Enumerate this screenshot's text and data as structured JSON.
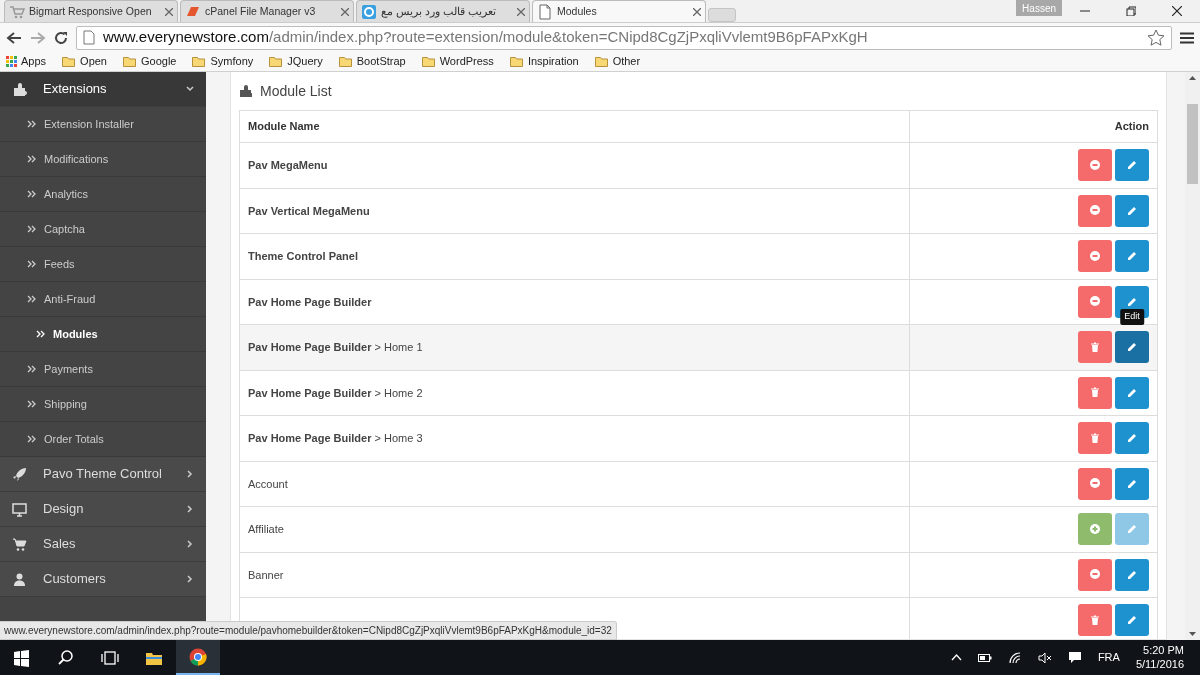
{
  "browser": {
    "tabs": [
      {
        "title": "Bigmart Responsive Open",
        "selected": false
      },
      {
        "title": "cPanel File Manager v3",
        "selected": false
      },
      {
        "title": "تعريب قالب ورد بريس مع",
        "selected": false
      },
      {
        "title": "Modules",
        "selected": true
      }
    ],
    "user": "Hassen",
    "address": {
      "host": "www.everynewstore.com",
      "path": "/admin/index.php?route=extension/module&token=CNipd8CgZjPxqliVvlemt9B6pFAPxKgH"
    },
    "bookmarks": [
      {
        "label": "Apps",
        "kind": "apps"
      },
      {
        "label": "Open",
        "kind": "folder"
      },
      {
        "label": "Google",
        "kind": "folder"
      },
      {
        "label": "Symfony",
        "kind": "folder"
      },
      {
        "label": "JQuery",
        "kind": "folder"
      },
      {
        "label": "BootStrap",
        "kind": "folder"
      },
      {
        "label": "WordPress",
        "kind": "folder"
      },
      {
        "label": "Inspiration",
        "kind": "folder"
      },
      {
        "label": "Other",
        "kind": "folder"
      }
    ],
    "status_url": "www.everynewstore.com/admin/index.php?route=module/pavhomebuilder&token=CNipd8CgZjPxqliVvlemt9B6pFAPxKgH&module_id=32"
  },
  "sidebar": {
    "items": [
      {
        "label": "Extensions",
        "expanded": true,
        "children": [
          {
            "label": "Extension Installer",
            "selected": false
          },
          {
            "label": "Modifications",
            "selected": false
          },
          {
            "label": "Analytics",
            "selected": false
          },
          {
            "label": "Captcha",
            "selected": false
          },
          {
            "label": "Feeds",
            "selected": false
          },
          {
            "label": "Anti-Fraud",
            "selected": false
          },
          {
            "label": "Modules",
            "selected": true
          },
          {
            "label": "Payments",
            "selected": false
          },
          {
            "label": "Shipping",
            "selected": false
          },
          {
            "label": "Order Totals",
            "selected": false
          }
        ]
      },
      {
        "label": "Pavo Theme Control",
        "expanded": false
      },
      {
        "label": "Design",
        "expanded": false
      },
      {
        "label": "Sales",
        "expanded": false
      },
      {
        "label": "Customers",
        "expanded": false
      }
    ]
  },
  "panel": {
    "title": "Module List",
    "table": {
      "columns": [
        "Module Name",
        "Action"
      ],
      "rows": [
        {
          "name": "Pav MegaMenu",
          "kind": "uninstall",
          "edit_disabled": false,
          "hovered": false
        },
        {
          "name": "Pav Vertical MegaMenu",
          "kind": "uninstall",
          "edit_disabled": false,
          "hovered": false
        },
        {
          "name": "Theme Control Panel",
          "kind": "uninstall",
          "edit_disabled": false,
          "hovered": false
        },
        {
          "name": "Pav Home Page Builder",
          "kind": "uninstall",
          "edit_disabled": false,
          "hovered": false
        },
        {
          "name": "Pav Home Page Builder",
          "sub": "> Home 1",
          "kind": "delete",
          "edit_disabled": false,
          "hovered": true,
          "tooltip": "Edit"
        },
        {
          "name": "Pav Home Page Builder",
          "sub": "> Home 2",
          "kind": "delete",
          "edit_disabled": false,
          "hovered": false
        },
        {
          "name": "Pav Home Page Builder",
          "sub": "> Home 3",
          "kind": "delete",
          "edit_disabled": false,
          "hovered": false
        },
        {
          "plain": "Account",
          "kind": "uninstall",
          "edit_disabled": false,
          "hovered": false
        },
        {
          "plain": "Affiliate",
          "kind": "install",
          "edit_disabled": true,
          "hovered": false
        },
        {
          "plain": "Banner",
          "kind": "uninstall",
          "edit_disabled": false,
          "hovered": false
        },
        {
          "kind": "delete",
          "edit_disabled": false,
          "hovered": false
        }
      ]
    }
  },
  "taskbar": {
    "apps": [
      {
        "kind": "start"
      },
      {
        "kind": "search"
      },
      {
        "kind": "taskview"
      },
      {
        "kind": "explorer",
        "selected": false
      },
      {
        "kind": "chrome",
        "selected": true
      }
    ],
    "language": "FRA",
    "time": "5:20 PM",
    "date": "5/11/2016"
  }
}
